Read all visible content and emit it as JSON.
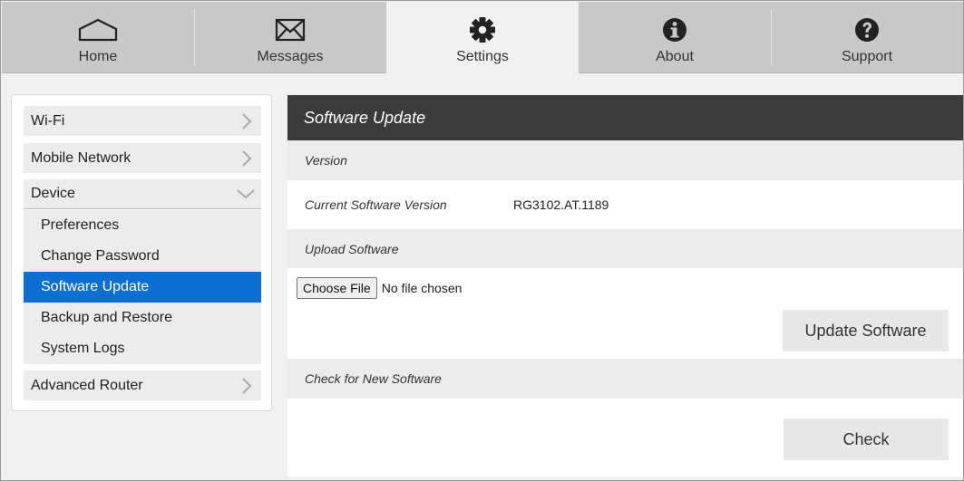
{
  "nav": {
    "tabs": [
      {
        "label": "Home",
        "icon": "home-icon",
        "active": false
      },
      {
        "label": "Messages",
        "icon": "envelope-icon",
        "active": false
      },
      {
        "label": "Settings",
        "icon": "gear-icon",
        "active": true
      },
      {
        "label": "About",
        "icon": "info-icon",
        "active": false
      },
      {
        "label": "Support",
        "icon": "question-icon",
        "active": false
      }
    ]
  },
  "sidebar": {
    "items": [
      {
        "label": "Wi-Fi",
        "icon": "chevron-right-icon"
      },
      {
        "label": "Mobile Network",
        "icon": "chevron-right-icon"
      },
      {
        "label": "Device",
        "icon": "chevron-down-icon",
        "expanded": true
      },
      {
        "label": "Advanced Router",
        "icon": "chevron-right-icon"
      }
    ],
    "device_subitems": [
      {
        "label": "Preferences",
        "active": false
      },
      {
        "label": "Change Password",
        "active": false
      },
      {
        "label": "Software Update",
        "active": true
      },
      {
        "label": "Backup and Restore",
        "active": false
      },
      {
        "label": "System Logs",
        "active": false
      }
    ]
  },
  "main": {
    "title": "Software Update",
    "version_section": {
      "heading": "Version",
      "current_label": "Current Software Version",
      "current_value": "RG3102.AT.1189"
    },
    "upload_section": {
      "heading": "Upload Software",
      "choose_file_label": "Choose File",
      "no_file_text": "No file chosen",
      "update_button": "Update Software"
    },
    "check_section": {
      "heading": "Check for New Software",
      "check_button": "Check"
    }
  },
  "colors": {
    "accent": "#0d6fd3",
    "header_dark": "#3b3b3b",
    "nav_bg": "#c8c8c8"
  }
}
